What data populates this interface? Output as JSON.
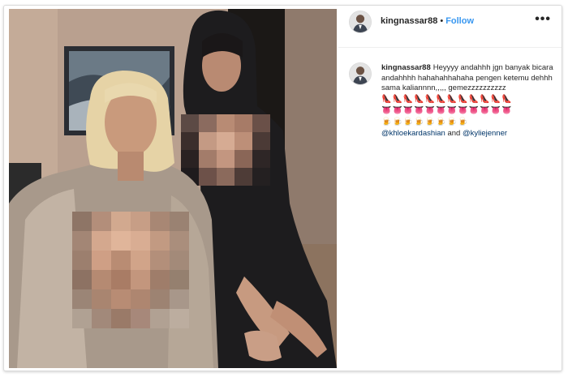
{
  "post": {
    "username": "kingnassar88",
    "dot": "•",
    "follow_label": "Follow",
    "more_label": "•••"
  },
  "caption": {
    "username": "kingnassar88",
    "text": "Heyyyy andahhh jgn banyak bicara andahhhh hahahahhahaha pengen ketemu dehhh sama kaliannnn,,,,, gemezzzzzzzzzz",
    "emoji_rows": [
      "👠👠👠👠👠👠👠👠👠👠👠👠",
      "👅👅👅👅👅👅👅👅👅👅👅👅",
      "🍺🍺🍺🍺🍺🍺🍺🍺"
    ],
    "tag_1": "@khloekardashian",
    "and_word": " and ",
    "tag_2": "@kyliejenner"
  },
  "colors": {
    "follow": "#3897f0",
    "tag": "#003569",
    "text": "#262626"
  },
  "icons": {
    "avatar": "avatar-icon",
    "more": "more-options-icon"
  }
}
